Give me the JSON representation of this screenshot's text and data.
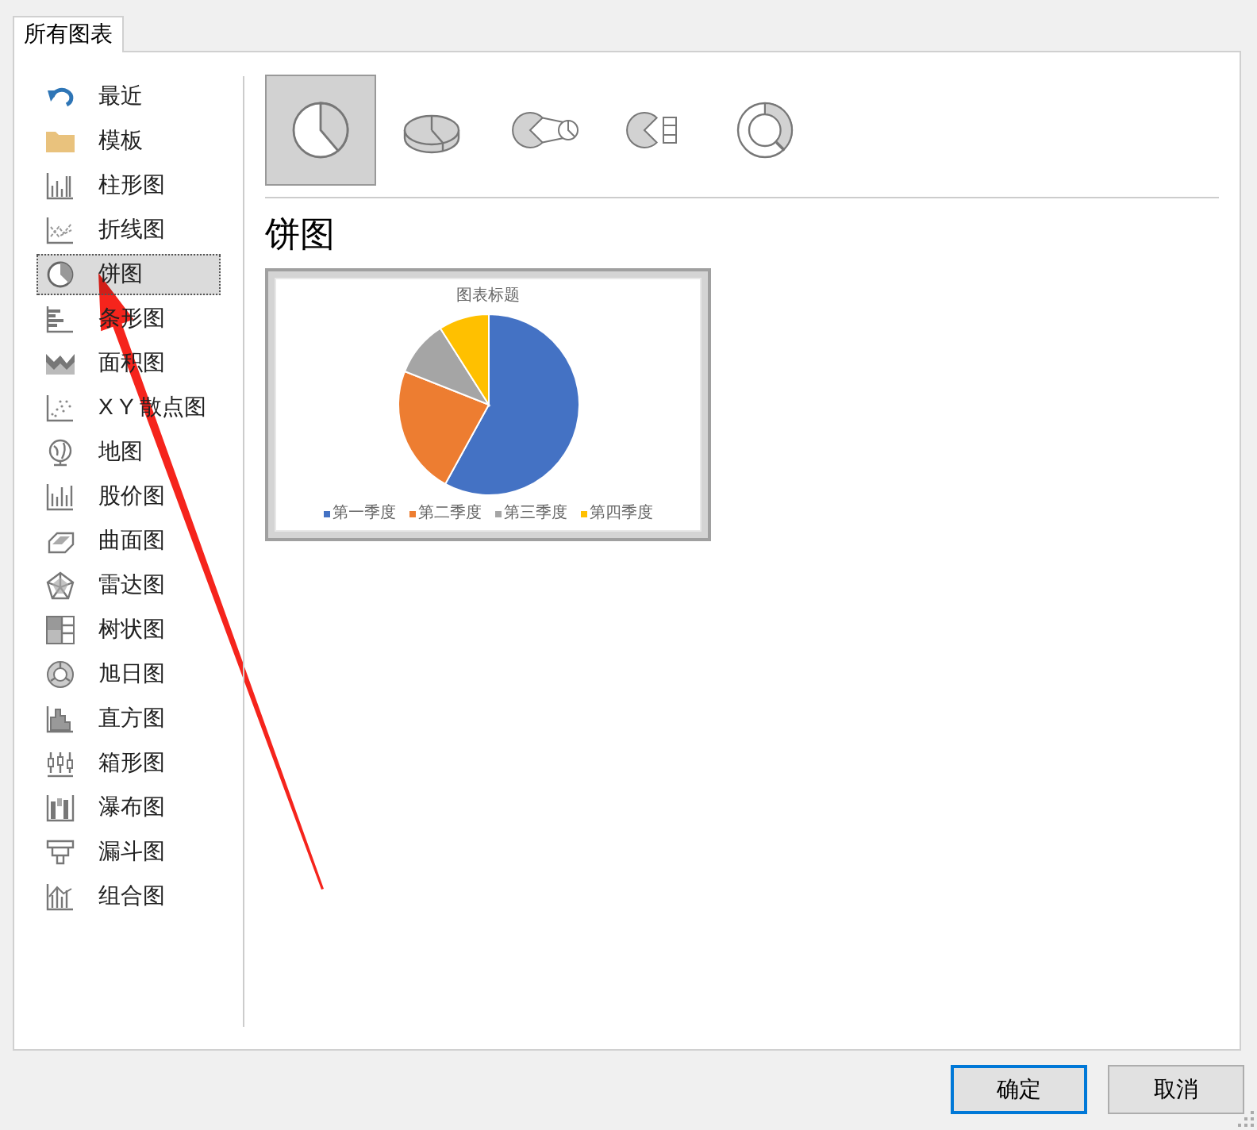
{
  "tabs": [
    {
      "label": "所有图表",
      "selected": true
    }
  ],
  "sidebar": {
    "items": [
      {
        "label": "最近",
        "selected": false
      },
      {
        "label": "模板",
        "selected": false
      },
      {
        "label": "柱形图",
        "selected": false
      },
      {
        "label": "折线图",
        "selected": false
      },
      {
        "label": "饼图",
        "selected": true
      },
      {
        "label": "条形图",
        "selected": false
      },
      {
        "label": "面积图",
        "selected": false
      },
      {
        "label": "X Y 散点图",
        "selected": false
      },
      {
        "label": "地图",
        "selected": false
      },
      {
        "label": "股价图",
        "selected": false
      },
      {
        "label": "曲面图",
        "selected": false
      },
      {
        "label": "雷达图",
        "selected": false
      },
      {
        "label": "树状图",
        "selected": false
      },
      {
        "label": "旭日图",
        "selected": false
      },
      {
        "label": "直方图",
        "selected": false
      },
      {
        "label": "箱形图",
        "selected": false
      },
      {
        "label": "瀑布图",
        "selected": false
      },
      {
        "label": "漏斗图",
        "selected": false
      },
      {
        "label": "组合图",
        "selected": false
      }
    ]
  },
  "chart_types": [
    {
      "selected": true
    },
    {
      "selected": false
    },
    {
      "selected": false
    },
    {
      "selected": false
    },
    {
      "selected": false
    }
  ],
  "heading": "饼图",
  "preview": {
    "title": "图表标题",
    "legend": [
      {
        "label": "第一季度",
        "color": "#4472c4"
      },
      {
        "label": "第二季度",
        "color": "#ed7d31"
      },
      {
        "label": "第三季度",
        "color": "#a5a5a5"
      },
      {
        "label": "第四季度",
        "color": "#ffc000"
      }
    ]
  },
  "buttons": [
    {
      "label": "确定",
      "kind": "default"
    },
    {
      "label": "取消",
      "kind": "normal"
    }
  ],
  "annotation": {
    "kind": "arrow"
  }
}
